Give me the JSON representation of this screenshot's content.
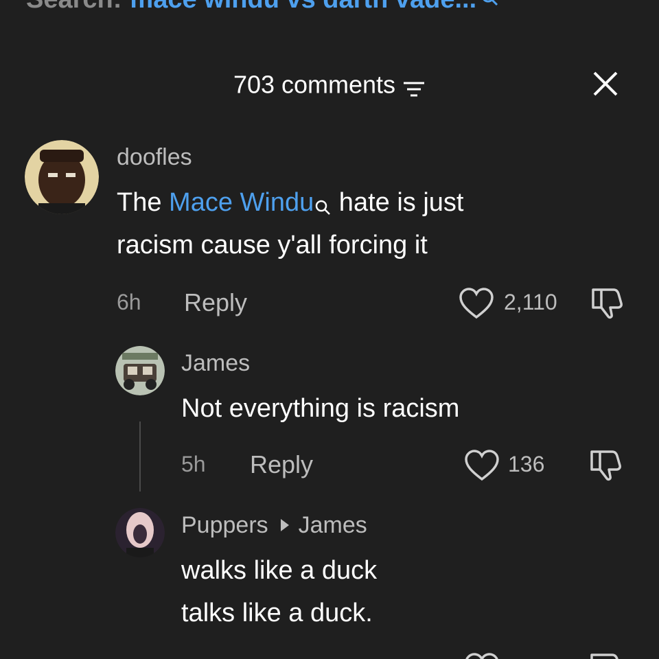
{
  "search": {
    "prefix": "Search:",
    "query": "mace windu vs darth vade..."
  },
  "header": {
    "comment_count": "703 comments"
  },
  "comments": [
    {
      "username": "doofles",
      "text_before": "The ",
      "link_text": "Mace Windu",
      "text_after": " hate is just",
      "text_line2": "racism cause y'all forcing it",
      "time": "6h",
      "reply_label": "Reply",
      "likes": "2,110"
    }
  ],
  "replies": [
    {
      "username": "James",
      "text": "Not everything is racism",
      "time": "5h",
      "reply_label": "Reply",
      "likes": "136"
    },
    {
      "username": "Puppers",
      "reply_to": "James",
      "text_line1": "walks like a duck",
      "text_line2": "talks like a duck."
    }
  ],
  "colors": {
    "background": "#1f1f1f",
    "link": "#4ea0ee",
    "muted": "#bdbdbd"
  },
  "icons": [
    "search-icon",
    "filter-icon",
    "close-icon",
    "heart-icon",
    "dislike-icon"
  ]
}
